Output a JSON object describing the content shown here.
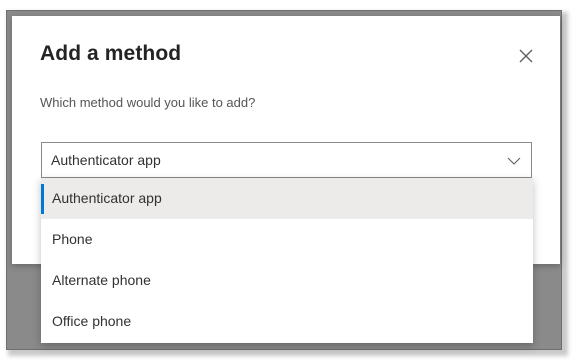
{
  "dialog": {
    "title": "Add a method",
    "prompt": "Which method would you like to add?",
    "close_icon": "close-icon"
  },
  "select": {
    "value": "Authenticator app",
    "chevron_icon": "chevron-down-icon",
    "options": [
      {
        "label": "Authenticator app",
        "selected": true
      },
      {
        "label": "Phone",
        "selected": false
      },
      {
        "label": "Alternate phone",
        "selected": false
      },
      {
        "label": "Office phone",
        "selected": false
      }
    ]
  },
  "colors": {
    "accent": "#0078d4",
    "selected_bg": "#edebe9",
    "backdrop": "#8a8a8a"
  }
}
